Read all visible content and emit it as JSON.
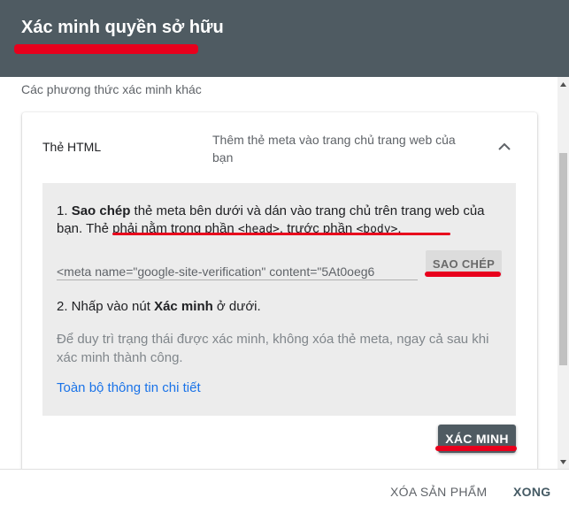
{
  "header": {
    "title": "Xác minh quyền sở hữu"
  },
  "subtitle": "Các phương thức xác minh khác",
  "method": {
    "label": "Thẻ HTML",
    "description": "Thêm thẻ meta vào trang chủ trang web của bạn",
    "collapse_icon": "chevron-up-icon"
  },
  "instructions": {
    "step1": {
      "prefix": "1. ",
      "action": "Sao chép",
      "text": " thẻ meta bên dưới và dán vào trang chủ trên trang web của bạn. ",
      "underline_start": "Thẻ phải nằm trong phần ",
      "code_head": "<head>",
      "underline_mid": ", trước phần ",
      "code_body": "<body>",
      "underline_end": "."
    },
    "meta_tag_value": "<meta name=\"google-site-verification\" content=\"5At0oeg6",
    "copy_label": "SAO CHÉP",
    "step2": {
      "prefix": "2. Nhấp vào nút ",
      "action": "Xác minh",
      "suffix": " ở dưới."
    },
    "note": "Để duy trì trạng thái được xác minh, không xóa thẻ meta, ngay cả sau khi xác minh thành công.",
    "details_link": "Toàn bộ thông tin chi tiết"
  },
  "verify_label": "XÁC MINH",
  "footer": {
    "remove_label": "XÓA SẢN PHẨM",
    "done_label": "XONG"
  },
  "colors": {
    "header_bg": "#4f5b62",
    "link": "#1a73e8",
    "annotation": "#e8001c"
  }
}
